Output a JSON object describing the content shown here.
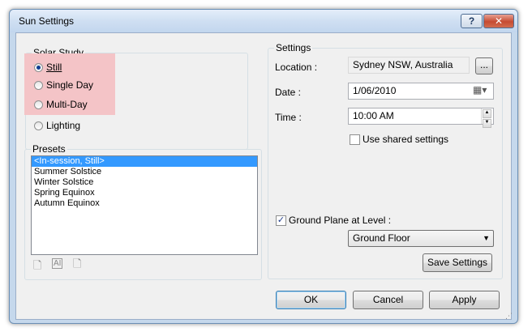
{
  "window": {
    "title": "Sun Settings",
    "help_label": "?",
    "close_label": "✕"
  },
  "solar_study": {
    "label": "Solar Study",
    "options": [
      {
        "id": "still",
        "label": "Still",
        "checked": true
      },
      {
        "id": "single-day",
        "label": "Single Day",
        "checked": false
      },
      {
        "id": "multi-day",
        "label": "Multi-Day",
        "checked": false
      },
      {
        "id": "lighting",
        "label": "Lighting",
        "checked": false
      }
    ]
  },
  "presets": {
    "label": "Presets",
    "items": [
      "<In-session, Still>",
      "Summer Solstice",
      "Winter Solstice",
      "Spring Equinox",
      "Autumn Equinox"
    ],
    "selected_index": 0,
    "icons": [
      "duplicate-preset-icon",
      "rename-preset-icon",
      "delete-preset-icon"
    ]
  },
  "settings": {
    "label": "Settings",
    "location_label": "Location :",
    "location_value": "Sydney NSW, Australia",
    "browse_label": "...",
    "date_label": "Date :",
    "date_value": "1/06/2010",
    "time_label": "Time :",
    "time_value": "10:00 AM",
    "use_shared_label": "Use shared settings",
    "use_shared_checked": false,
    "ground_plane_label": "Ground Plane at Level :",
    "ground_plane_checked": true,
    "level_value": "Ground Floor",
    "save_label": "Save Settings"
  },
  "footer": {
    "ok_label": "OK",
    "cancel_label": "Cancel",
    "apply_label": "Apply"
  },
  "colors": {
    "highlight": "#f4c4c7",
    "selection": "#3399ff"
  }
}
